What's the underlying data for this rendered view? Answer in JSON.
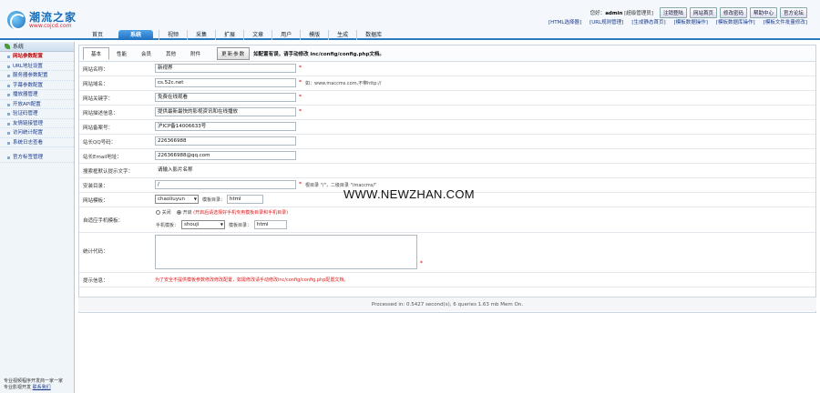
{
  "logo": {
    "cn": "潮流之家",
    "en": "www.cojcd.com"
  },
  "user": {
    "prefix": "您好：",
    "name": "admin",
    "role": "[超级管理员]"
  },
  "user_buttons": [
    "注销登陆",
    "网站首页",
    "修改密码",
    "帮助中心",
    "官方论坛"
  ],
  "quick_links": [
    "[HTML选择器]",
    "[URL规则管理]",
    "[生成静态首页]",
    "[模板数据操作]",
    "[模板数据库操作]",
    "[模板文件批量修改]"
  ],
  "nav": {
    "home": "首页",
    "tabs": [
      "系统",
      "视频",
      "采集",
      "扩展",
      "文章",
      "用户",
      "模版",
      "生成",
      "数据库"
    ],
    "active_index": 0
  },
  "sidebar": {
    "title": "系统",
    "items": [
      "网站参数配置",
      "URL地址设置",
      "服务器参数配置",
      "字幕参数配置",
      "播放器管理",
      "开放API配置",
      "验证码管理",
      "友情链接管理",
      "访问统计配置",
      "系统日志查看"
    ],
    "active_index": 0,
    "extra_item": "官方标签管理",
    "footer_text": "专业视频程序开发商一家一家",
    "footer_link_prefix": "专业影视开发",
    "footer_link": "联系我们"
  },
  "settings_tabs": [
    "基本",
    "性能",
    "会员",
    "其他",
    "附件"
  ],
  "settings_tab_active": 0,
  "param_button": "更新参数",
  "param_tip": "如配置有误，请手动修改 inc/config/config.php文档。",
  "form": {
    "site_name": {
      "label": "网站名称：",
      "value": "新视界"
    },
    "site_url": {
      "label": "网站域名：",
      "value": "cs.52c.net",
      "hint": "如：www.maccms.com,不带http://"
    },
    "site_keywords": {
      "label": "网站关键字：",
      "value": "免费在线观看"
    },
    "site_desc": {
      "label": "网站描述信息：",
      "value": "提供最新最快的影视资讯和在线播放"
    },
    "icp": {
      "label": "网站备案号：",
      "value": "沪ICP备14006633号"
    },
    "qq": {
      "label": "站长QQ号码：",
      "value": "226366988"
    },
    "email": {
      "label": "站长Email地址：",
      "value": "226366988@qq.com"
    },
    "search_tip": {
      "label": "搜索框默认提示文字：",
      "value": "请输入影片名称"
    },
    "install_dir": {
      "label": "安装目录：",
      "value": "/",
      "hint": "根目录 \"/\"，二级目录 \"/maccms/\""
    },
    "template": {
      "label": "网站模板：",
      "select_value": "chaoliuyun",
      "dir_label": "模板目录：",
      "dir_value": "html"
    },
    "mobile": {
      "label": "自适应手机模板：",
      "option_off": "关闭",
      "option_on": "开启",
      "note": "(开启后请选择好手机专用模板目录和手机目录)",
      "tpl_label": "手机模板：",
      "tpl_value": "shouji",
      "dir_label": "模板目录：",
      "dir_value": "html"
    },
    "stats": {
      "label": "统计代码："
    },
    "notice": {
      "label": "提示信息：",
      "value": "为了安全不提供模板参数修改修改配置，如需修改请手动修改inc/config/config.php配置文档。"
    }
  },
  "watermark": "WWW.NEWZHAN.COM",
  "status": "Processed in: 0.5427 second(s), 6 queries 1.63 mb Mem On."
}
